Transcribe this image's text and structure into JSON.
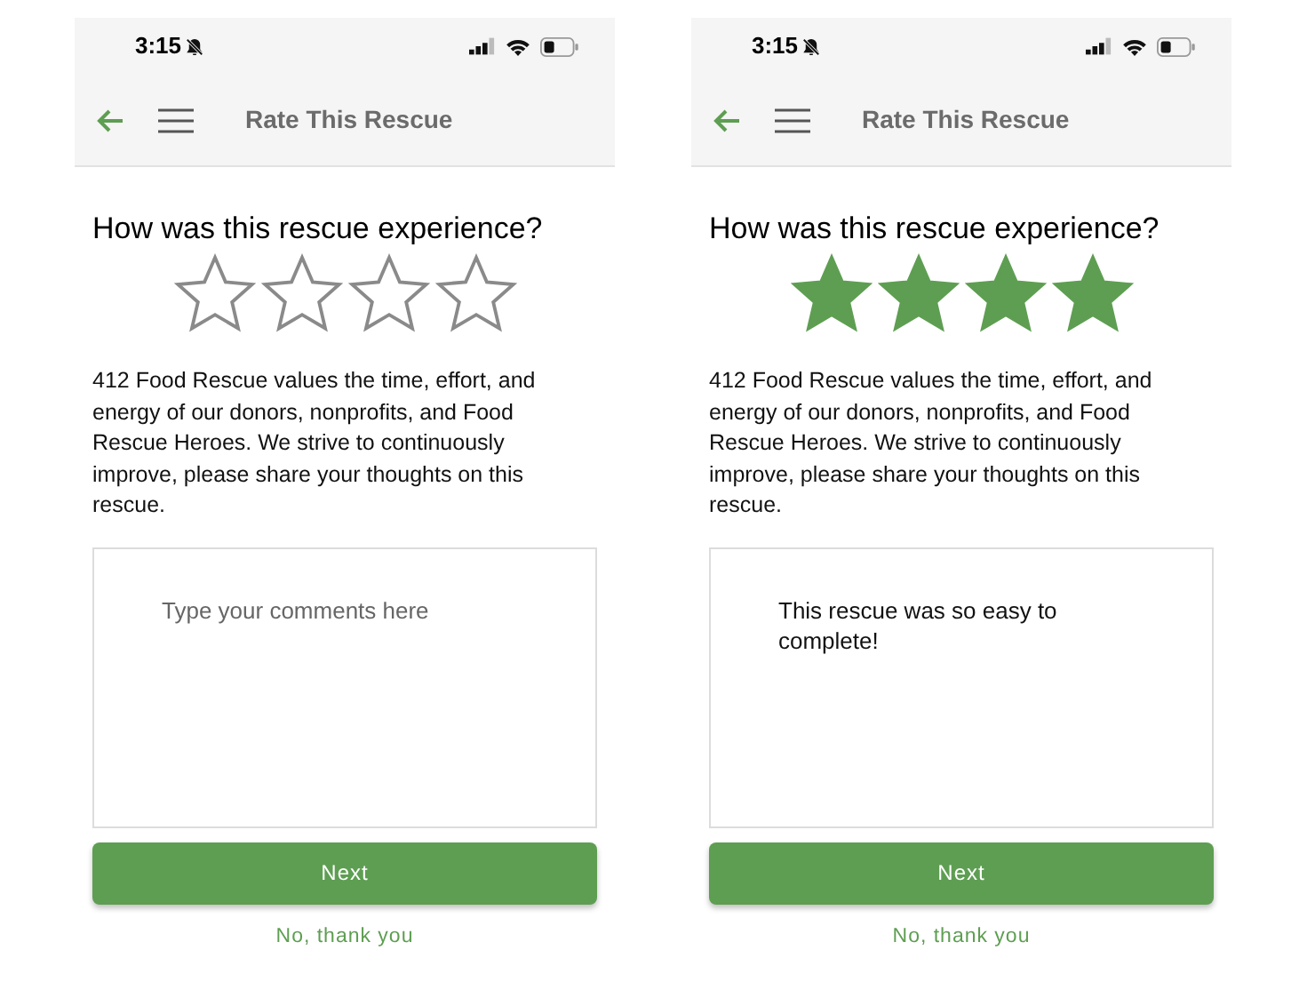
{
  "screens": [
    {
      "status_bar": {
        "time": "3:15"
      },
      "header": {
        "title": "Rate This Rescue"
      },
      "question": "How was this rescue experience?",
      "rating": {
        "stars": 0
      },
      "description": "412 Food Rescue values the time, effort, and energy of our donors, nonprofits, and Food Rescue Heroes. We strive to continuously improve, please share your thoughts on this rescue.",
      "comment": {
        "placeholder": "Type your comments here"
      },
      "next_button": "Next",
      "decline_link": "No, thank you"
    },
    {
      "status_bar": {
        "time": "3:15"
      },
      "header": {
        "title": "Rate This Rescue"
      },
      "question": "How was this rescue experience?",
      "rating": {
        "stars": 4
      },
      "description": "412 Food Rescue values the time, effort, and energy of our donors, nonprofits, and Food Rescue Heroes. We strive to continuously improve, please share your thoughts on this rescue.",
      "comment": {
        "value": "This rescue was so easy to complete!"
      },
      "next_button": "Next",
      "decline_link": "No, thank you"
    }
  ]
}
